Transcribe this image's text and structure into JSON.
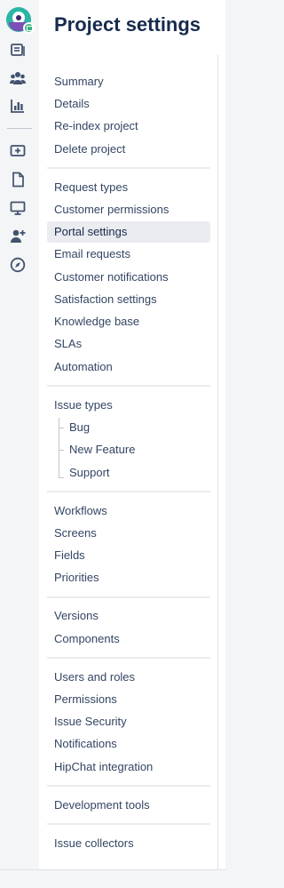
{
  "header": {
    "title": "Project settings"
  },
  "rail": {
    "icons": [
      "project-avatar-icon",
      "queues-icon",
      "customers-icon",
      "reports-icon",
      "add-item-icon",
      "pages-icon",
      "customer-channels-icon",
      "invite-team-icon",
      "compass-icon"
    ]
  },
  "nav": {
    "summary": "Summary",
    "details": "Details",
    "reindex": "Re-index project",
    "delete": "Delete project",
    "request_types": "Request types",
    "customer_permissions": "Customer permissions",
    "portal_settings": "Portal settings",
    "email_requests": "Email requests",
    "customer_notifications": "Customer notifications",
    "satisfaction_settings": "Satisfaction settings",
    "knowledge_base": "Knowledge base",
    "slas": "SLAs",
    "automation": "Automation",
    "issue_types": "Issue types",
    "bug": "Bug",
    "new_feature": "New Feature",
    "support": "Support",
    "workflows": "Workflows",
    "screens": "Screens",
    "fields": "Fields",
    "priorities": "Priorities",
    "versions": "Versions",
    "components": "Components",
    "users_roles": "Users and roles",
    "permissions": "Permissions",
    "issue_security": "Issue Security",
    "notifications": "Notifications",
    "hipchat": "HipChat integration",
    "dev_tools": "Development tools",
    "issue_collectors": "Issue collectors"
  },
  "active_item": "Portal settings",
  "colors": {
    "active_bg": "#ebecf0",
    "text": "#344563",
    "title": "#172b4d",
    "avatar": "#2bb5a6"
  }
}
